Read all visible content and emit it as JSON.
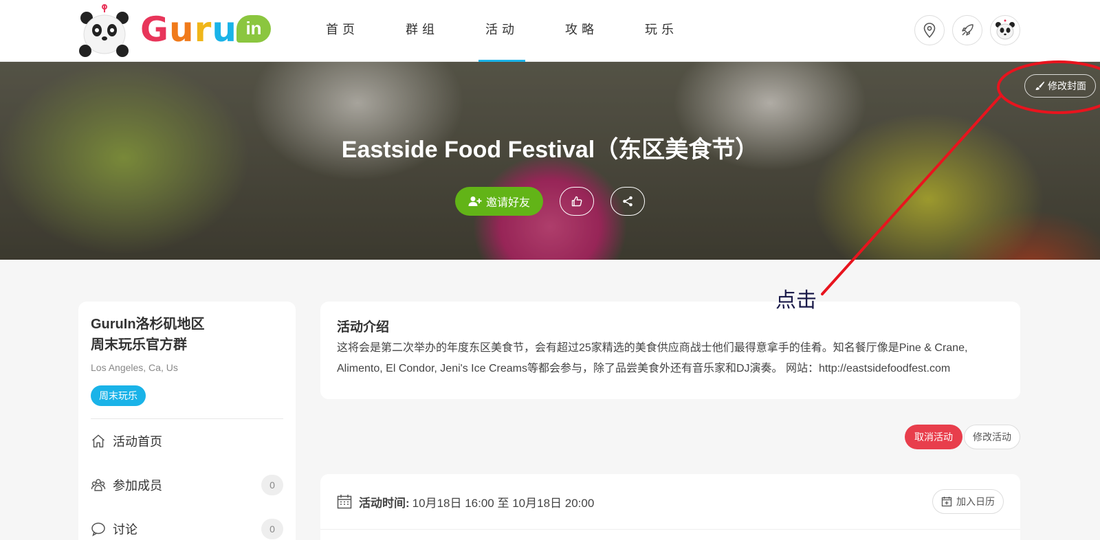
{
  "header": {
    "logo": {
      "g": "G",
      "u1": "u",
      "r": "r",
      "u2": "u",
      "in": "in"
    },
    "nav": [
      {
        "label": "首页",
        "active": false
      },
      {
        "label": "群组",
        "active": false
      },
      {
        "label": "活动",
        "active": true
      },
      {
        "label": "攻略",
        "active": false
      },
      {
        "label": "玩乐",
        "active": false
      }
    ],
    "icons": [
      "location-icon",
      "rocket-icon",
      "avatar"
    ]
  },
  "banner": {
    "title": "Eastside Food Festival（东区美食节）",
    "invite_label": "邀请好友",
    "edit_cover_label": "修改封面",
    "annotation_label": "点击",
    "annotation_color": "#e8141e"
  },
  "sidebar": {
    "group_name_line1": "GuruIn洛杉矶地区",
    "group_name_line2": "周末玩乐官方群",
    "location": "Los Angeles, Ca, Us",
    "tag": "周末玩乐",
    "items": [
      {
        "label": "活动首页",
        "icon": "home-icon",
        "count": ""
      },
      {
        "label": "参加成员",
        "icon": "members-icon",
        "count": "0"
      },
      {
        "label": "讨论",
        "icon": "chat-icon",
        "count": "0"
      }
    ]
  },
  "main": {
    "intro_title": "活动介绍",
    "intro_text": "这将会是第二次举办的年度东区美食节，会有超过25家精选的美食供应商战士他们最得意拿手的佳肴。知名餐厅像是Pine & Crane, Alimento, El Condor, Jeni's Ice Creams等都会参与，除了品尝美食外还有音乐家和DJ演奏。 网站：http://eastsidefoodfest.com",
    "cancel_label": "取消活动",
    "edit_label": "修改活动",
    "time_key": "活动时间:",
    "time_value": "10月18日 16:00 至 10月18日 20:00",
    "calendar_label": "加入日历"
  },
  "colors": {
    "accent": "#1ab3e8",
    "invite": "#62b417",
    "danger": "#e83e4c"
  }
}
